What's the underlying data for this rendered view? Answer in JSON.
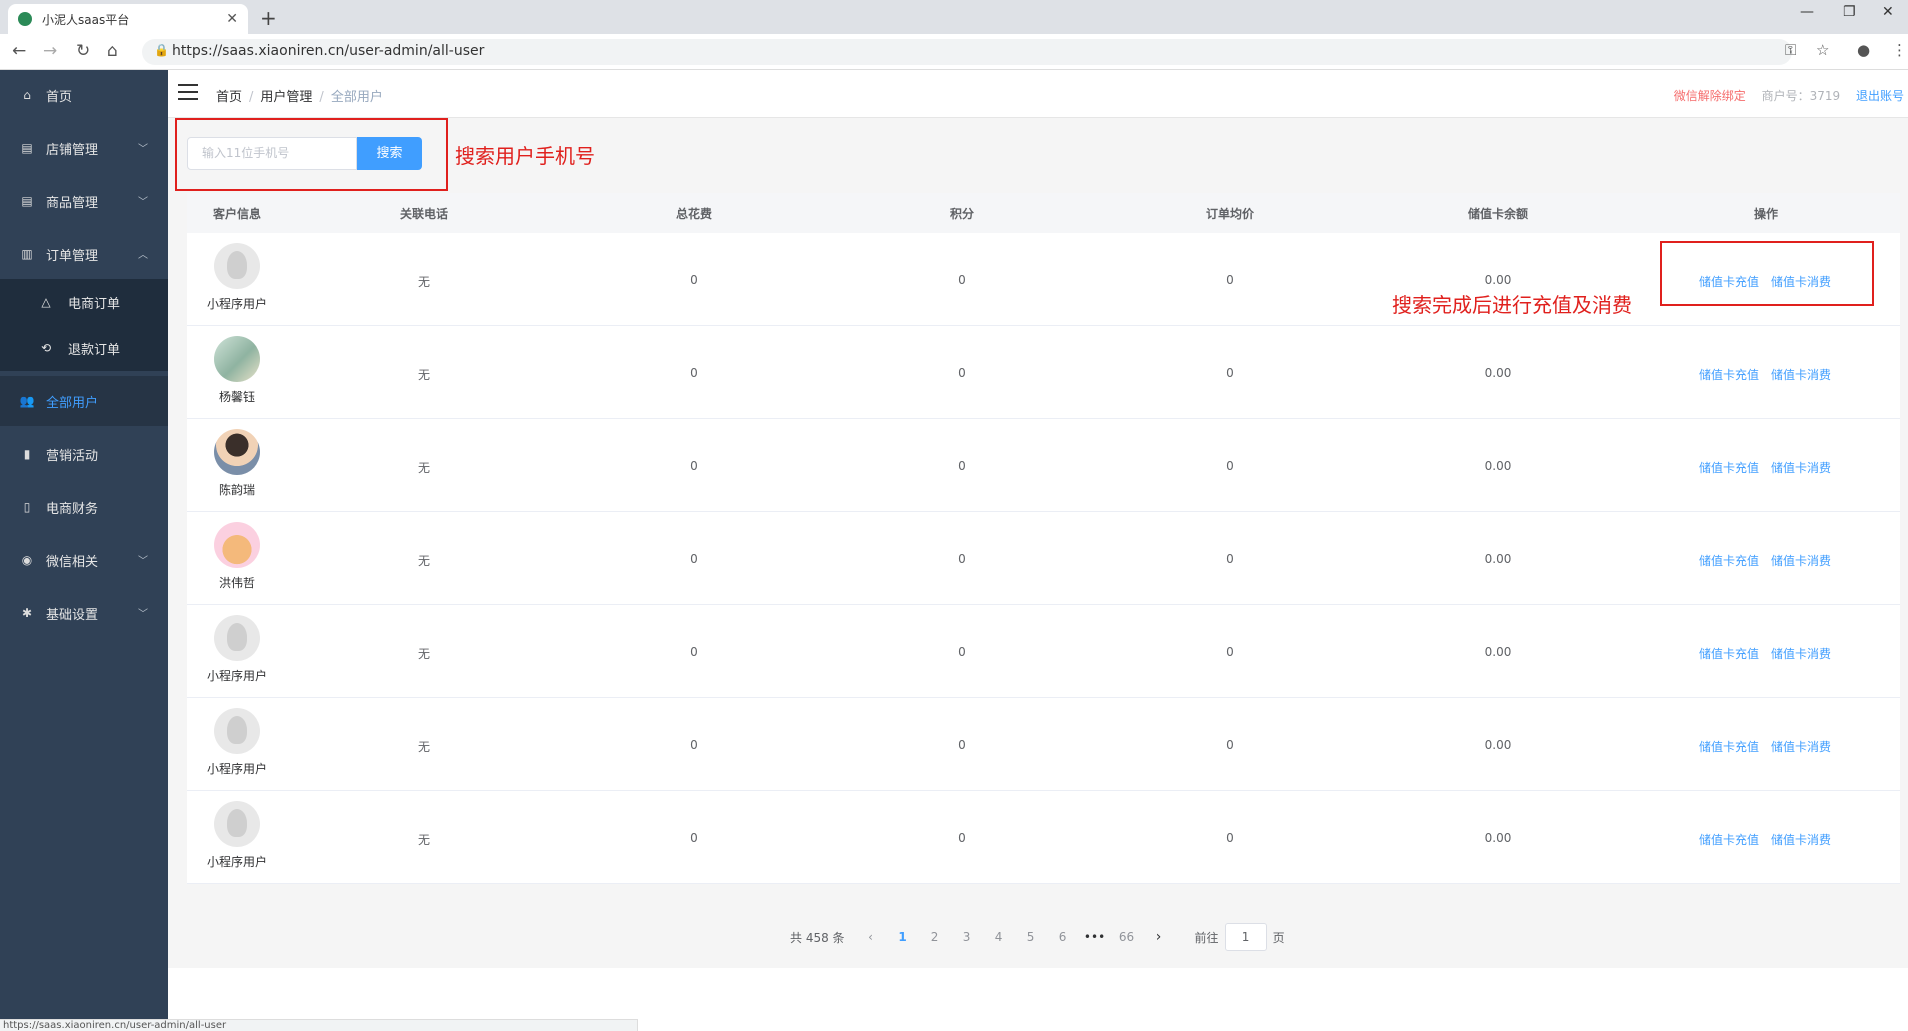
{
  "browser": {
    "tab_title": "小泥人saas平台",
    "url": "https://saas.xiaoniren.cn/user-admin/all-user",
    "status_url": "https://saas.xiaoniren.cn/user-admin/all-user"
  },
  "sidebar": {
    "items": [
      {
        "label": "首页",
        "icon": "home-icon"
      },
      {
        "label": "店铺管理",
        "icon": "shop-icon"
      },
      {
        "label": "商品管理",
        "icon": "goods-icon"
      },
      {
        "label": "订单管理",
        "icon": "order-icon"
      },
      {
        "label": "全部用户",
        "icon": "users-icon"
      },
      {
        "label": "营销活动",
        "icon": "marketing-icon"
      },
      {
        "label": "电商财务",
        "icon": "finance-icon"
      },
      {
        "label": "微信相关",
        "icon": "wechat-icon"
      },
      {
        "label": "基础设置",
        "icon": "gear-icon"
      }
    ],
    "submenu": [
      {
        "label": "电商订单",
        "icon": "warning-icon"
      },
      {
        "label": "退款订单",
        "icon": "refund-icon"
      }
    ]
  },
  "header": {
    "breadcrumb": [
      "首页",
      "用户管理",
      "全部用户"
    ],
    "unbind": "微信解除绑定",
    "merchant": "商户号：3719",
    "logout": "退出账号"
  },
  "search": {
    "placeholder": "输入11位手机号",
    "button": "搜索",
    "annotation": "搜索用户手机号"
  },
  "table": {
    "columns": [
      "客户信息",
      "关联电话",
      "总花费",
      "积分",
      "订单均价",
      "储值卡余额",
      "操作"
    ],
    "rows": [
      {
        "name": "小程序用户",
        "phone": "无",
        "total": "0",
        "points": "0",
        "avg": "0",
        "balance": "0.00"
      },
      {
        "name": "杨馨钰",
        "phone": "无",
        "total": "0",
        "points": "0",
        "avg": "0",
        "balance": "0.00"
      },
      {
        "name": "陈韵瑞",
        "phone": "无",
        "total": "0",
        "points": "0",
        "avg": "0",
        "balance": "0.00"
      },
      {
        "name": "洪伟哲",
        "phone": "无",
        "total": "0",
        "points": "0",
        "avg": "0",
        "balance": "0.00"
      },
      {
        "name": "小程序用户",
        "phone": "无",
        "total": "0",
        "points": "0",
        "avg": "0",
        "balance": "0.00"
      },
      {
        "name": "小程序用户",
        "phone": "无",
        "total": "0",
        "points": "0",
        "avg": "0",
        "balance": "0.00"
      },
      {
        "name": "小程序用户",
        "phone": "无",
        "total": "0",
        "points": "0",
        "avg": "0",
        "balance": "0.00"
      }
    ],
    "op_recharge": "储值卡充值",
    "op_consume": "储值卡消费",
    "annotation": "搜索完成后进行充值及消费"
  },
  "pagination": {
    "total": "共 458 条",
    "pages": [
      "1",
      "2",
      "3",
      "4",
      "5",
      "6",
      "•••",
      "66"
    ],
    "current": "1",
    "goto_label": "前往",
    "goto_value": "1",
    "page_suffix": "页"
  }
}
